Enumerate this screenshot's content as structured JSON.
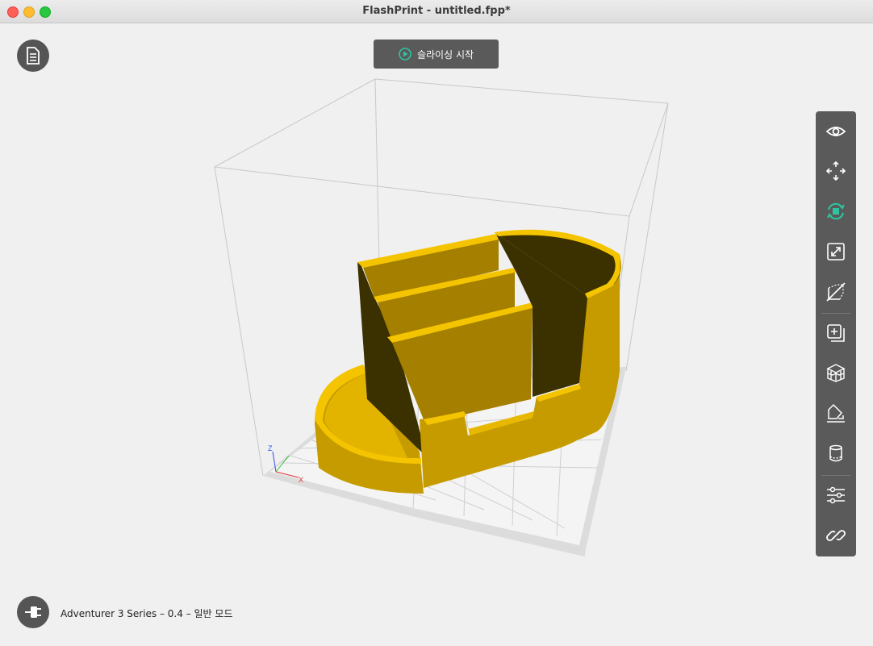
{
  "window": {
    "title": "FlashPrint - untitled.fpp*"
  },
  "toolbar_top": {
    "slice_label": "슬라이싱 시작",
    "file_icon": "document-icon"
  },
  "right_toolbar": {
    "tools": [
      {
        "name": "view",
        "icon": "eye-icon"
      },
      {
        "name": "move",
        "icon": "move-arrows-icon"
      },
      {
        "name": "rotate",
        "icon": "rotate-icon",
        "active": true
      },
      {
        "name": "scale",
        "icon": "scale-icon"
      },
      {
        "name": "cut",
        "icon": "cut-icon"
      },
      {
        "name": "add-model",
        "icon": "add-model-icon"
      },
      {
        "name": "supports",
        "icon": "support-icon"
      },
      {
        "name": "lay-flat",
        "icon": "lay-flat-icon"
      },
      {
        "name": "raft",
        "icon": "cylinder-icon"
      },
      {
        "name": "settings",
        "icon": "sliders-icon"
      },
      {
        "name": "connect",
        "icon": "link-icon"
      }
    ],
    "active_color": "#2ec4a0"
  },
  "axes": {
    "z": "Z",
    "x": "X"
  },
  "status": {
    "printer_text": "Adventurer 3 Series – 0.4 – 일반 모드",
    "icon": "plug-icon"
  },
  "colors": {
    "model_top": "#f5c400",
    "model_side": "#c79d00",
    "model_dark": "#3a3000"
  }
}
